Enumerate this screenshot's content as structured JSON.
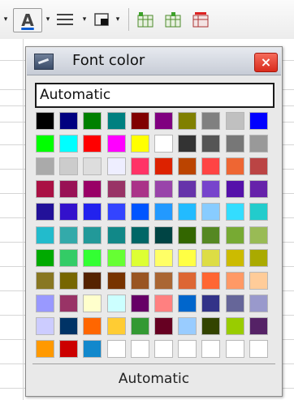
{
  "toolbar": {
    "font_color_glyph": "A",
    "icons": [
      "font-color-icon",
      "line-style-icon",
      "borders-icon",
      "insert-column-icon",
      "insert-column-after-icon",
      "delete-column-icon"
    ]
  },
  "popup": {
    "title": "Font color",
    "close_glyph": "×",
    "automatic_field": "Automatic",
    "automatic_button": "Automatic"
  },
  "swatch_colors": [
    [
      "#000000",
      "#000080",
      "#008000",
      "#008080",
      "#800000",
      "#800080",
      "#808000",
      "#808080",
      "#c0c0c0",
      "#0000ff"
    ],
    [
      "#00ff00",
      "#00ffff",
      "#ff0000",
      "#ff00ff",
      "#ffff00",
      "#ffffff",
      "#333333",
      "#555555",
      "#777777",
      "#999999"
    ],
    [
      "#aaaaaa",
      "#cccccc",
      "#dddddd",
      "#eeeeff",
      "#ff3366",
      "#dd2200",
      "#bb4400",
      "#ff4444",
      "#ee6633",
      "#bb4444"
    ],
    [
      "#aa1144",
      "#991155",
      "#990066",
      "#993366",
      "#aa3388",
      "#9944aa",
      "#6633aa",
      "#7744cc",
      "#5511aa",
      "#6622aa"
    ],
    [
      "#221199",
      "#3311cc",
      "#2222ee",
      "#3344ff",
      "#0055ff",
      "#2299ff",
      "#22bbff",
      "#88ccff",
      "#33ddff",
      "#22cccc"
    ],
    [
      "#22bbcc",
      "#33aaaa",
      "#229999",
      "#118888",
      "#006666",
      "#004444",
      "#336600",
      "#558822",
      "#77aa33",
      "#99bb55"
    ],
    [
      "#00aa00",
      "#33cc66",
      "#33ff33",
      "#66ff33",
      "#ddff33",
      "#ffff66",
      "#ffff44",
      "#dddd44",
      "#ccbb00",
      "#aaaa00"
    ],
    [
      "#887722",
      "#776600",
      "#552200",
      "#773300",
      "#995522",
      "#aa6633",
      "#dd6633",
      "#ff6633",
      "#ff9966",
      "#ffcc99"
    ],
    [
      "#9999ff",
      "#993366",
      "#ffffcc",
      "#ccffff",
      "#660066",
      "#ff8080",
      "#0066cc",
      "#333388",
      "#666699",
      "#9999cc"
    ],
    [
      "#ccccff",
      "#003366",
      "#ff6600",
      "#ffcc33",
      "#339933",
      "#660022",
      "#99ccff",
      "#334400",
      "#99cc00",
      "#552266"
    ],
    [
      "#ff9900",
      "#cc0000",
      "#1188cc",
      "#ffffff",
      "#ffffff",
      "#ffffff",
      "#ffffff",
      "#ffffff",
      "#ffffff",
      "#ffffff"
    ]
  ]
}
